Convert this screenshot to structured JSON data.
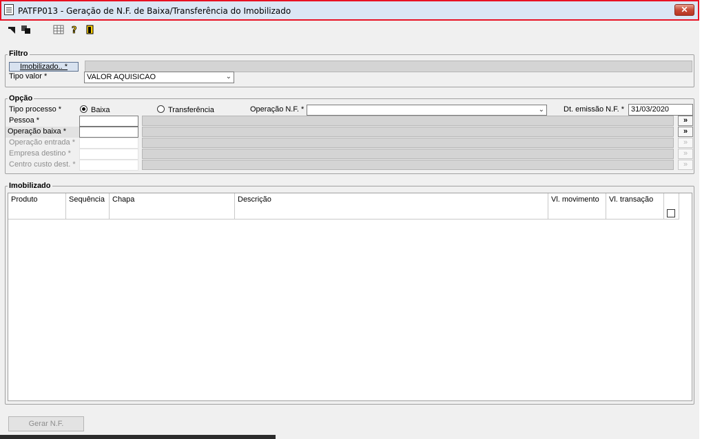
{
  "window": {
    "title": "PATFP013 - Geração de N.F. de Baixa/Transferência do Imobilizado",
    "close_glyph": "✕"
  },
  "toolbar": {
    "icons": [
      "arrow-icon",
      "copy-icon",
      "table-icon",
      "help-icon",
      "exit-icon"
    ]
  },
  "filtro": {
    "group_label": "Filtro",
    "imobilizado_button": "Imobilizado.. *",
    "tipo_valor_label": "Tipo valor *",
    "tipo_valor_value": "VALOR AQUISICAO"
  },
  "opcao": {
    "group_label": "Opção",
    "tipo_processo_label": "Tipo processo *",
    "radio_baixa": "Baixa",
    "radio_transferencia": "Transferência",
    "operacao_nf_label": "Operação N.F. *",
    "operacao_nf_value": "",
    "dt_emissao_label": "Dt. emissão N.F. *",
    "dt_emissao_value": "31/03/2020",
    "pessoa_label": "Pessoa *",
    "operacao_baixa_label": "Operação baixa *",
    "operacao_entrada_label": "Operação entrada *",
    "empresa_destino_label": "Empresa destino *",
    "centro_custo_label": "Centro custo dest. *",
    "more_glyph": "»"
  },
  "imobilizado": {
    "group_label": "Imobilizado",
    "columns": [
      "Produto",
      "Sequência",
      "Chapa",
      "Descrição",
      "Vl. movimento",
      "Vl. transação"
    ]
  },
  "footer": {
    "gerar_button": "Gerar N.F."
  },
  "colors": {
    "accent_border": "#e81123",
    "title_bg": "#dbe6f4",
    "window_bg": "#f0f0f0"
  }
}
